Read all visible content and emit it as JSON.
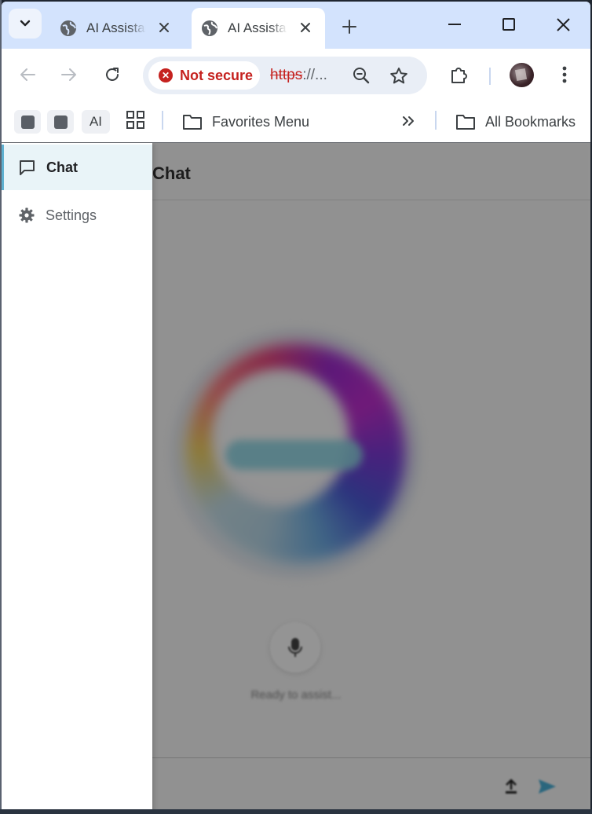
{
  "browser": {
    "tabs": [
      {
        "title": "AI Assistant",
        "active": false
      },
      {
        "title": "AI Assistant",
        "active": true
      }
    ],
    "security_chip": "Not secure",
    "url_scheme": "https",
    "url_rest": "://...",
    "bookmarks": {
      "ai_label": "AI",
      "favorites_folder": "Favorites Menu",
      "all_bookmarks": "All Bookmarks"
    }
  },
  "app": {
    "page_title": "Chat",
    "nav": [
      {
        "label": "Chat",
        "icon": "chat-bubble-icon",
        "active": true
      },
      {
        "label": "Settings",
        "icon": "gear-icon",
        "active": false
      }
    ],
    "status": "Ready to assist..."
  },
  "colors": {
    "tabstrip": "#d3e3fd",
    "not_secure": "#c5221f",
    "nav_active_bg": "#e9f4f8",
    "nav_active_border": "#5fb0d0",
    "send": "#4ab0d8"
  }
}
